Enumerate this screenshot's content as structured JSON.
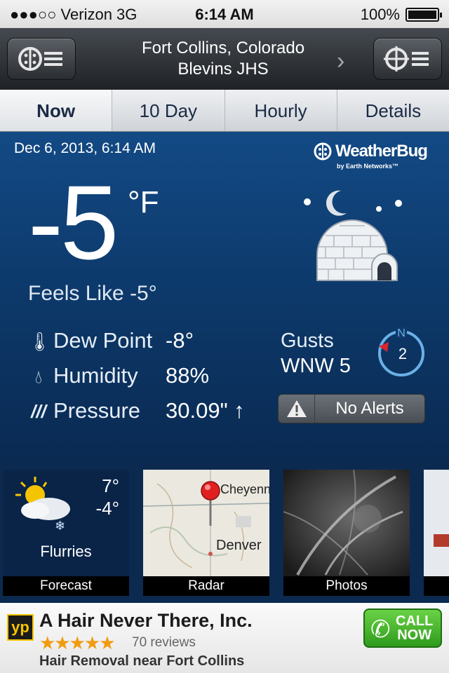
{
  "status_bar": {
    "carrier": "●●●○○ Verizon   3G",
    "time": "6:14 AM",
    "battery": "100%"
  },
  "header": {
    "city": "Fort Collins, Colorado",
    "station": "Blevins JHS"
  },
  "tabs": [
    {
      "label": "Now",
      "active": true
    },
    {
      "label": "10 Day",
      "active": false
    },
    {
      "label": "Hourly",
      "active": false
    },
    {
      "label": "Details",
      "active": false
    }
  ],
  "current": {
    "datetime": "Dec 6, 2013, 6:14 AM",
    "brand": "WeatherBug",
    "brand_sub": "by Earth Networks™",
    "temp": "-5",
    "unit": "°F",
    "feels_like": "Feels Like -5°",
    "condition_icon": "igloo-night-icon",
    "stats": [
      {
        "icon": "thermometer-icon",
        "label": "Dew Point",
        "value": "-8°"
      },
      {
        "icon": "humidity-drop-icon",
        "label": "Humidity",
        "value": "88%"
      },
      {
        "icon": "pressure-icon",
        "label": "Pressure",
        "value": "30.09\" ↑"
      }
    ],
    "gusts_label": "Gusts",
    "gusts_value": "WNW 5",
    "compass": {
      "north": "N",
      "speed": "2"
    },
    "alerts": "No Alerts"
  },
  "thumbs": [
    {
      "caption": "Forecast",
      "hi": "7°",
      "lo": "-4°",
      "condition": "Flurries"
    },
    {
      "caption": "Radar",
      "cities": [
        "Cheyenn",
        "Denver"
      ]
    },
    {
      "caption": "Photos"
    }
  ],
  "ad": {
    "logo": "yp",
    "title": "A Hair Never There, Inc.",
    "stars": "★★★★★",
    "reviews": "70 reviews",
    "subtitle": "Hair Removal near Fort Collins",
    "call_line1": "CALL",
    "call_line2": "NOW"
  },
  "colors": {
    "panel": "#0d3a6c",
    "accent_red": "#d9262c",
    "compass": "#6ab0e6"
  }
}
